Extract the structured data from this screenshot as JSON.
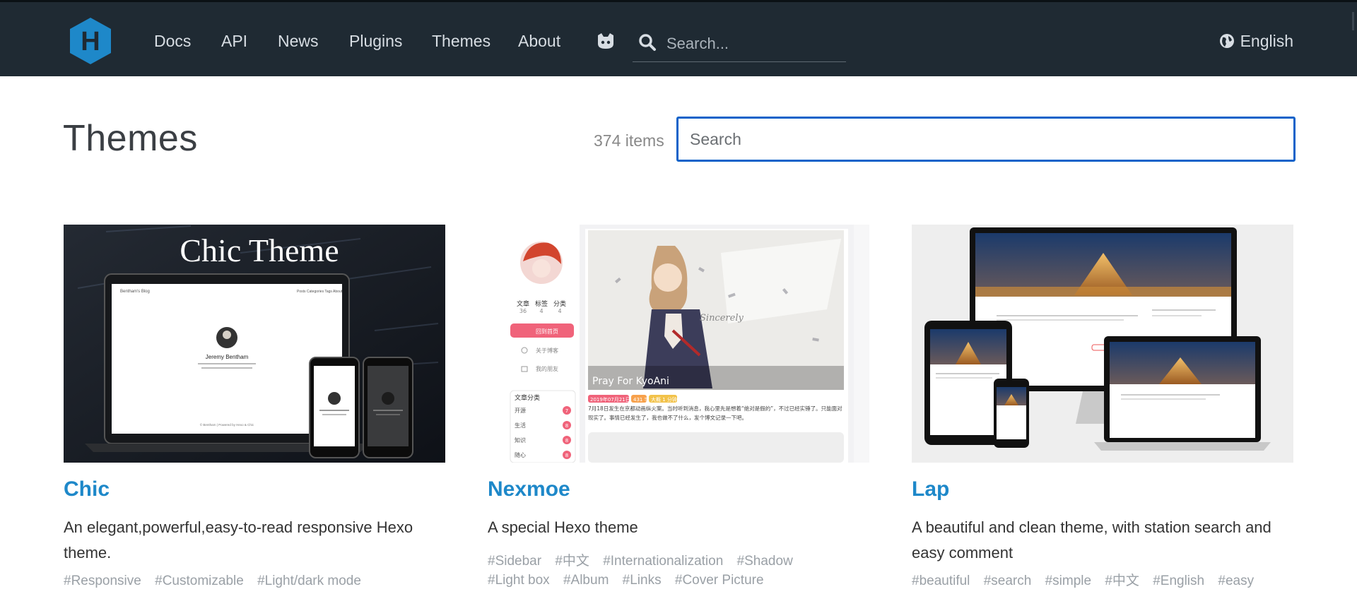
{
  "header": {
    "logo_letter": "H",
    "nav": [
      "Docs",
      "API",
      "News",
      "Plugins",
      "Themes",
      "About"
    ],
    "search_placeholder": "Search...",
    "language": "English",
    "icons": {
      "github": "github-icon",
      "search": "search-icon",
      "globe": "globe-icon"
    }
  },
  "page": {
    "title": "Themes",
    "count": "374 items",
    "search_placeholder": "Search"
  },
  "cards": [
    {
      "name": "Chic",
      "description": "An elegant,powerful,easy-to-read responsive Hexo theme.",
      "tags": [
        "#Responsive",
        "#Customizable",
        "#Light/dark mode"
      ],
      "preview": {
        "banner": "Chic Theme",
        "blog_title": "Bentham's Blog",
        "menu": [
          "Posts",
          "Categories",
          "Tags",
          "About"
        ],
        "author": "Jeremy Bentham",
        "footer": "© Bentham | Powered by Hexo & Chic"
      }
    },
    {
      "name": "Nexmoe",
      "description": "A special Hexo theme",
      "tags": [
        "#Sidebar",
        "#中文",
        "#Internationalization",
        "#Shadow",
        "#Light box",
        "#Album",
        "#Links",
        "#Cover Picture"
      ],
      "preview": {
        "stats": [
          {
            "label": "文章",
            "value": "36"
          },
          {
            "label": "标签",
            "value": "4"
          },
          {
            "label": "分类",
            "value": "4"
          }
        ],
        "menu": [
          "回到首页",
          "关于博客",
          "我的朋友"
        ],
        "category_title": "文章分类",
        "categories": [
          {
            "name": "开源",
            "count": "7"
          },
          {
            "name": "生活",
            "count": "8"
          },
          {
            "name": "知识",
            "count": "8"
          },
          {
            "name": "随心",
            "count": "8"
          }
        ],
        "post_title": "Pray For KyoAni",
        "post_badges": [
          "2019年07月21日",
          "431 字",
          "大概 1 分钟"
        ],
        "post_excerpt": "7月18日发生在京都动画纵火案。当时听到消息，我心里先是想着“绝对是假的”，不过已经实锤了。只能面对现实了。事情已经发生了，我也做不了什么，发个博文记录一下吧。"
      }
    },
    {
      "name": "Lap",
      "description": "A beautiful and clean theme, with station search and easy comment",
      "tags": [
        "#beautiful",
        "#search",
        "#simple",
        "#中文",
        "#English",
        "#easy"
      ],
      "preview": {}
    }
  ],
  "colors": {
    "header_bg": "#1f2a33",
    "logo": "#1e88c9",
    "link": "#1e88c9",
    "search_border": "#0e62c9",
    "tag": "#9aa0a6"
  }
}
